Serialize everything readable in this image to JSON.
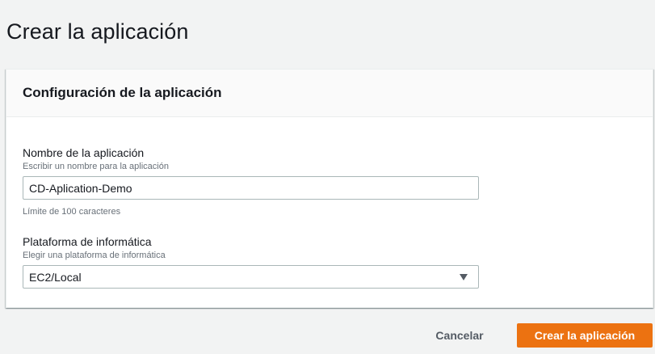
{
  "page": {
    "title": "Crear la aplicación"
  },
  "panel": {
    "header": "Configuración de la aplicación",
    "app_name": {
      "label": "Nombre de la aplicación",
      "description": "Escribir un nombre para la aplicación",
      "value": "CD-Aplication-Demo",
      "constraint": "Límite de 100 caracteres"
    },
    "platform": {
      "label": "Plataforma de informática",
      "description": "Elegir una plataforma de informática",
      "selected": "EC2/Local",
      "icon": "caret-down-icon"
    }
  },
  "actions": {
    "cancel_label": "Cancelar",
    "create_label": "Crear la aplicación"
  },
  "colors": {
    "primary": "#ec7211",
    "background": "#f2f3f3",
    "text": "#16191f",
    "muted": "#687078"
  }
}
